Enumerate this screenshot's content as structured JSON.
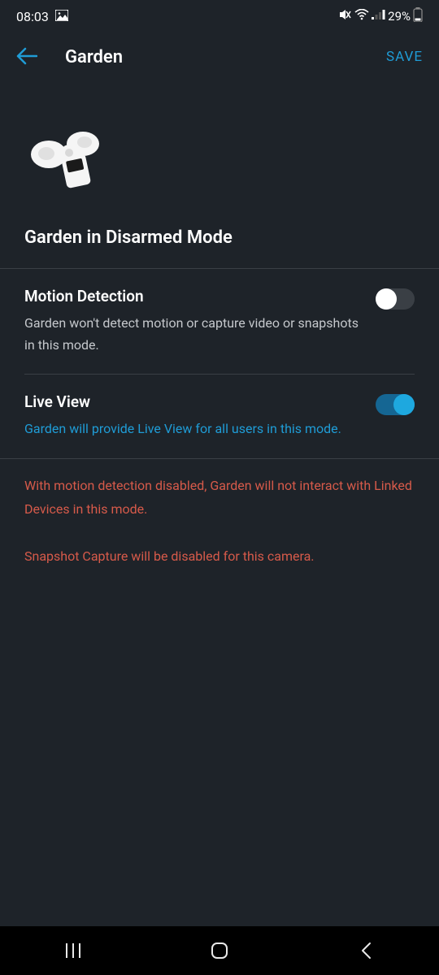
{
  "status_bar": {
    "time": "08:03",
    "battery": "29%"
  },
  "header": {
    "title": "Garden",
    "save_label": "SAVE"
  },
  "mode_title": "Garden in Disarmed Mode",
  "settings": {
    "motion": {
      "title": "Motion Detection",
      "desc": "Garden won't detect motion or capture video or snapshots in this mode.",
      "enabled": false
    },
    "live": {
      "title": "Live View",
      "desc": "Garden will provide Live View for all users in this mode.",
      "enabled": true
    }
  },
  "warnings": {
    "line1": "With motion detection disabled, Garden will not interact with Linked Devices in this mode.",
    "line2": "Snapshot Capture will be disabled for this camera."
  }
}
